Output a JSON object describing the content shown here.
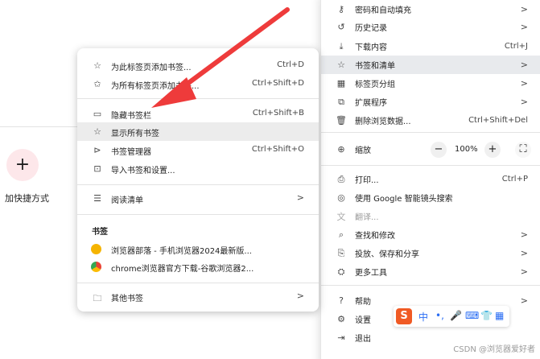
{
  "page": {
    "add_shortcut_label": "加快捷方式",
    "add_shortcut_glyph": "+"
  },
  "main_menu": {
    "items": [
      {
        "icon": "key-icon",
        "label": "密码和自动填充",
        "arrow": ">"
      },
      {
        "icon": "history-icon",
        "label": "历史记录",
        "arrow": ">"
      },
      {
        "icon": "download-icon",
        "label": "下载内容",
        "shortcut": "Ctrl+J"
      },
      {
        "icon": "star-icon",
        "label": "书签和清单",
        "arrow": ">"
      },
      {
        "icon": "tab-groups-icon",
        "label": "标签页分组",
        "arrow": ">"
      },
      {
        "icon": "extensions-icon",
        "label": "扩展程序",
        "arrow": ">"
      },
      {
        "icon": "trash-icon",
        "label": "删除浏览数据...",
        "shortcut": "Ctrl+Shift+Del"
      },
      {
        "icon": "zoom-icon",
        "label": "缩放"
      },
      {
        "icon": "print-icon",
        "label": "打印...",
        "shortcut": "Ctrl+P"
      },
      {
        "icon": "google-lens-icon",
        "label": "使用 Google 智能镜头搜索"
      },
      {
        "icon": "translate-icon",
        "label": "翻译..."
      },
      {
        "icon": "find-icon",
        "label": "查找和修改",
        "arrow": ">"
      },
      {
        "icon": "cast-icon",
        "label": "投放、保存和分享",
        "arrow": ">"
      },
      {
        "icon": "toolbox-icon",
        "label": "更多工具",
        "arrow": ">"
      },
      {
        "icon": "help-icon",
        "label": "帮助",
        "arrow": ">"
      },
      {
        "icon": "settings-icon",
        "label": "设置"
      },
      {
        "icon": "exit-icon",
        "label": "退出"
      }
    ],
    "zoom": {
      "minus": "−",
      "value": "100%",
      "plus": "+",
      "fullscreen": "⛶"
    }
  },
  "bookmarks_submenu": {
    "items": [
      {
        "icon": "star-add-icon",
        "label": "为此标签页添加书签...",
        "shortcut": "Ctrl+D"
      },
      {
        "icon": "star-multi-icon",
        "label": "为所有标签页添加书签...",
        "shortcut": "Ctrl+Shift+D"
      },
      {
        "icon": "bookmark-bar-icon",
        "label": "隐藏书签栏",
        "shortcut": "Ctrl+Shift+B"
      },
      {
        "icon": "star-outline-icon",
        "label": "显示所有书签"
      },
      {
        "icon": "bookmark-manager-icon",
        "label": "书签管理器",
        "shortcut": "Ctrl+Shift+O"
      },
      {
        "icon": "import-icon",
        "label": "导入书签和设置..."
      },
      {
        "icon": "reading-list-icon",
        "label": "阅读清单",
        "arrow": ">"
      }
    ],
    "section_heading": "书签",
    "bookmarks": [
      {
        "label": "浏览器部落 - 手机浏览器2024最新版...",
        "color": "#f5b400"
      },
      {
        "label": "chrome浏览器官方下载-谷歌浏览器2...",
        "color": "#34a853"
      }
    ],
    "other": {
      "label": "其他书签",
      "arrow": ">"
    }
  },
  "ime_toolbar": {
    "logo": "S",
    "items": [
      "中",
      "•,",
      "🎤",
      "⌨",
      "👕",
      "▦"
    ]
  },
  "watermark": "CSDN @浏览器爱好者",
  "colors": {
    "arrow": "#ee3b3b",
    "highlight": "#e8eaed",
    "plus_bg": "#fde7ea",
    "ime_logo": "#f05a24"
  }
}
